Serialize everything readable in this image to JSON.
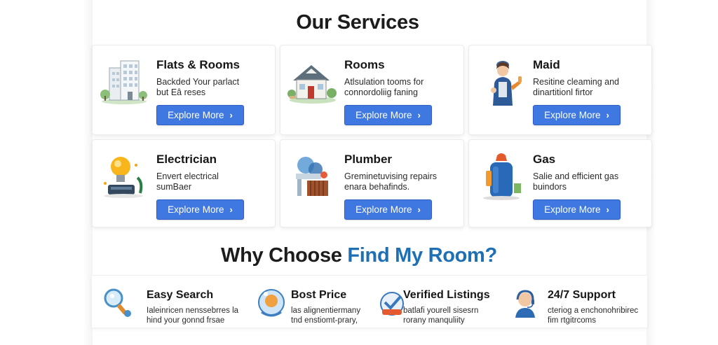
{
  "services": {
    "title": "Our Services",
    "button_label": "Explore More",
    "items": [
      {
        "title": "Flats & Rooms",
        "desc_line1": "Backded Your parlact",
        "desc_line2": "but Eâ reses",
        "icon": "apartment-building-icon"
      },
      {
        "title": "Rooms",
        "desc_line1": "Atlsulation tooms for",
        "desc_line2": "connordoliig faning",
        "icon": "house-icon"
      },
      {
        "title": "Maid",
        "desc_line1": "Resitine cleaming and",
        "desc_line2": "dinartitionl firtor",
        "icon": "maid-icon"
      },
      {
        "title": "Electrician",
        "desc_line1": "Envert electrical",
        "desc_line2": "sumBaer",
        "icon": "lightbulb-icon"
      },
      {
        "title": "Plumber",
        "desc_line1": "Greminetuvising repairs",
        "desc_line2": "enara behafinds.",
        "icon": "plumbing-icon"
      },
      {
        "title": "Gas",
        "desc_line1": "Salie and efficient gas",
        "desc_line2": "buindors",
        "icon": "gas-cylinder-icon"
      }
    ]
  },
  "why": {
    "title_prefix": "Why Choose ",
    "title_brand": "Find My Room?",
    "features": [
      {
        "title": "Easy Search",
        "desc_line1": "Ialeinricen nenssebrres la",
        "desc_line2": "hind your gonnd frsae",
        "icon": "search-icon"
      },
      {
        "title": "Bost Price",
        "desc_line1": "las alignentiermany",
        "desc_line2": "tnd enstiomt-prary,",
        "icon": "price-tag-icon"
      },
      {
        "title": "Verified Listings",
        "desc_line1": "batlafi yourell sisesrn",
        "desc_line2": "rorany manquliity",
        "icon": "verified-badge-icon"
      },
      {
        "title": "24/7 Support",
        "desc_line1": "cteriog a enchonohribirec",
        "desc_line2": "fim rtgitrcoms",
        "icon": "support-agent-icon"
      }
    ]
  },
  "colors": {
    "accent": "#3f78e0",
    "brand": "#1f6fb5"
  }
}
